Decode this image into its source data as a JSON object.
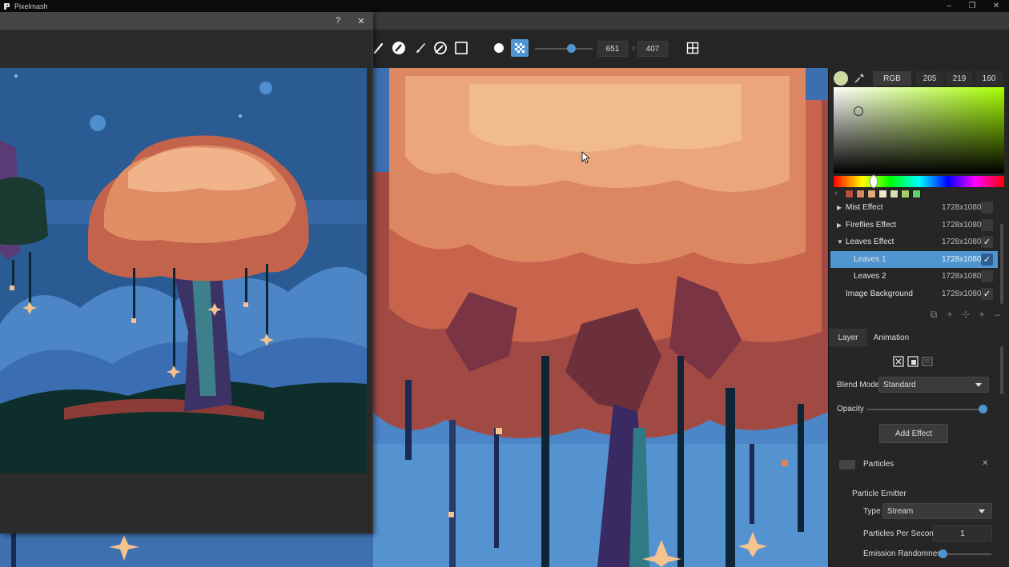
{
  "app": {
    "title": "Pixelmash"
  },
  "window_controls": {
    "minimize": "–",
    "maximize": "❐",
    "close": "✕"
  },
  "preview": {
    "help": "?",
    "close": "✕"
  },
  "toolbar": {
    "width_value": "651",
    "height_value": "407",
    "times": "x",
    "brush_size_fraction": 0.65
  },
  "colorpicker": {
    "mode": "RGB",
    "r": "205",
    "g": "219",
    "b": "160",
    "current_color": "#cddba0",
    "swatches": [
      "#b34f3c",
      "#d38a5e",
      "#e2a878",
      "#efe6cc",
      "#d6dfb0",
      "#9fcf6a",
      "#5fd26a"
    ]
  },
  "layers": [
    {
      "name": "Mist Effect",
      "size": "1728x1080",
      "expander": "▶",
      "visible": false,
      "selected": false,
      "indent": false
    },
    {
      "name": "Fireflies Effect",
      "size": "1728x1080",
      "expander": "▶",
      "visible": false,
      "selected": false,
      "indent": false
    },
    {
      "name": "Leaves Effect",
      "size": "1728x1080",
      "expander": "▼",
      "visible": true,
      "selected": false,
      "indent": false
    },
    {
      "name": "Leaves 1",
      "size": "1728x1080",
      "expander": "",
      "visible": true,
      "selected": true,
      "indent": true
    },
    {
      "name": "Leaves 2",
      "size": "1728x1080",
      "expander": "",
      "visible": false,
      "selected": false,
      "indent": true
    },
    {
      "name": "Image Background",
      "size": "1728x1080",
      "expander": "",
      "visible": true,
      "selected": false,
      "indent": false
    }
  ],
  "layer_buttons": [
    "⧉",
    "+",
    "⊹",
    "+",
    "–"
  ],
  "tabs": {
    "layer": "Layer",
    "animation": "Animation"
  },
  "props": {
    "blend_mode_label": "Blend Mode",
    "blend_mode_value": "Standard",
    "opacity_label": "Opacity",
    "opacity_value": 1.0,
    "add_effect": "Add Effect",
    "particles_label": "Particles",
    "particle_emitter": "Particle Emitter",
    "type_label": "Type",
    "type_value": "Stream",
    "pps_label": "Particles Per Second",
    "pps_value": "1",
    "emission_label": "Emission Randomness",
    "emission_value": 0.0,
    "close": "✕"
  },
  "colors": {
    "accent": "#4f95d0",
    "panel": "#262626"
  }
}
